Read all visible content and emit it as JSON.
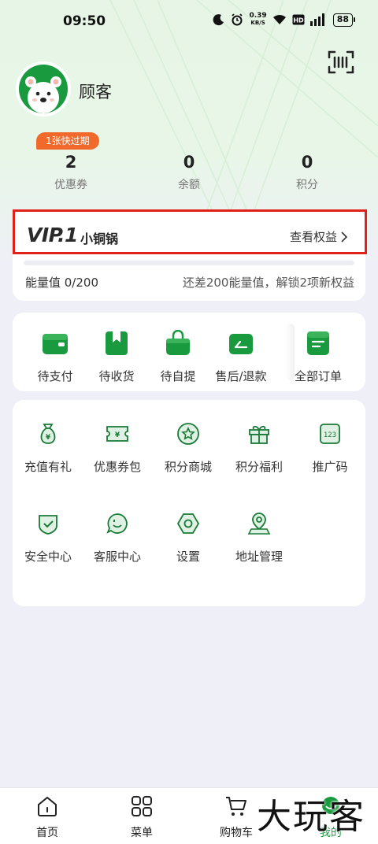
{
  "status_bar": {
    "time": "09:50",
    "net_speed_value": "0.39",
    "net_speed_unit": "KB/S",
    "battery": "88"
  },
  "profile": {
    "username": "顾客"
  },
  "coupon_badge": "1张快过期",
  "stats": [
    {
      "value": "2",
      "label": "优惠券"
    },
    {
      "value": "0",
      "label": "余额"
    },
    {
      "value": "0",
      "label": "积分"
    }
  ],
  "vip": {
    "level": "VIP.1",
    "name": "小铜锅",
    "benefits_link": "查看权益",
    "energy_label": "能量值 0/200",
    "energy_progress": 0.0,
    "tip": "还差200能量值，解锁2项新权益"
  },
  "orders": [
    {
      "label": "待支付",
      "icon": "wallet-icon"
    },
    {
      "label": "待收货",
      "icon": "package-icon"
    },
    {
      "label": "待自提",
      "icon": "shopping-bag-icon"
    },
    {
      "label": "售后/退款",
      "icon": "refund-icon"
    },
    {
      "label": "全部订单",
      "icon": "order-list-icon"
    }
  ],
  "tools": [
    {
      "label": "充值有礼",
      "icon": "money-bag-icon"
    },
    {
      "label": "优惠券包",
      "icon": "coupon-icon"
    },
    {
      "label": "积分商城",
      "icon": "star-icon"
    },
    {
      "label": "积分福利",
      "icon": "gift-icon"
    },
    {
      "label": "推广码",
      "icon": "promo-code-icon"
    },
    {
      "label": "安全中心",
      "icon": "shield-icon"
    },
    {
      "label": "客服中心",
      "icon": "chat-icon"
    },
    {
      "label": "设置",
      "icon": "settings-icon"
    },
    {
      "label": "地址管理",
      "icon": "location-icon"
    }
  ],
  "tabs": [
    {
      "label": "首页",
      "icon": "home-icon"
    },
    {
      "label": "菜单",
      "icon": "menu-grid-icon"
    },
    {
      "label": "购物车",
      "icon": "cart-icon"
    },
    {
      "label": "我的",
      "icon": "profile-icon",
      "active": true
    }
  ],
  "watermark": "大玩客",
  "colors": {
    "brand_green": "#1a9a3e",
    "badge_orange": "#f26a2b",
    "highlight_red": "#e0211a",
    "page_bg": "#eeeff7"
  }
}
